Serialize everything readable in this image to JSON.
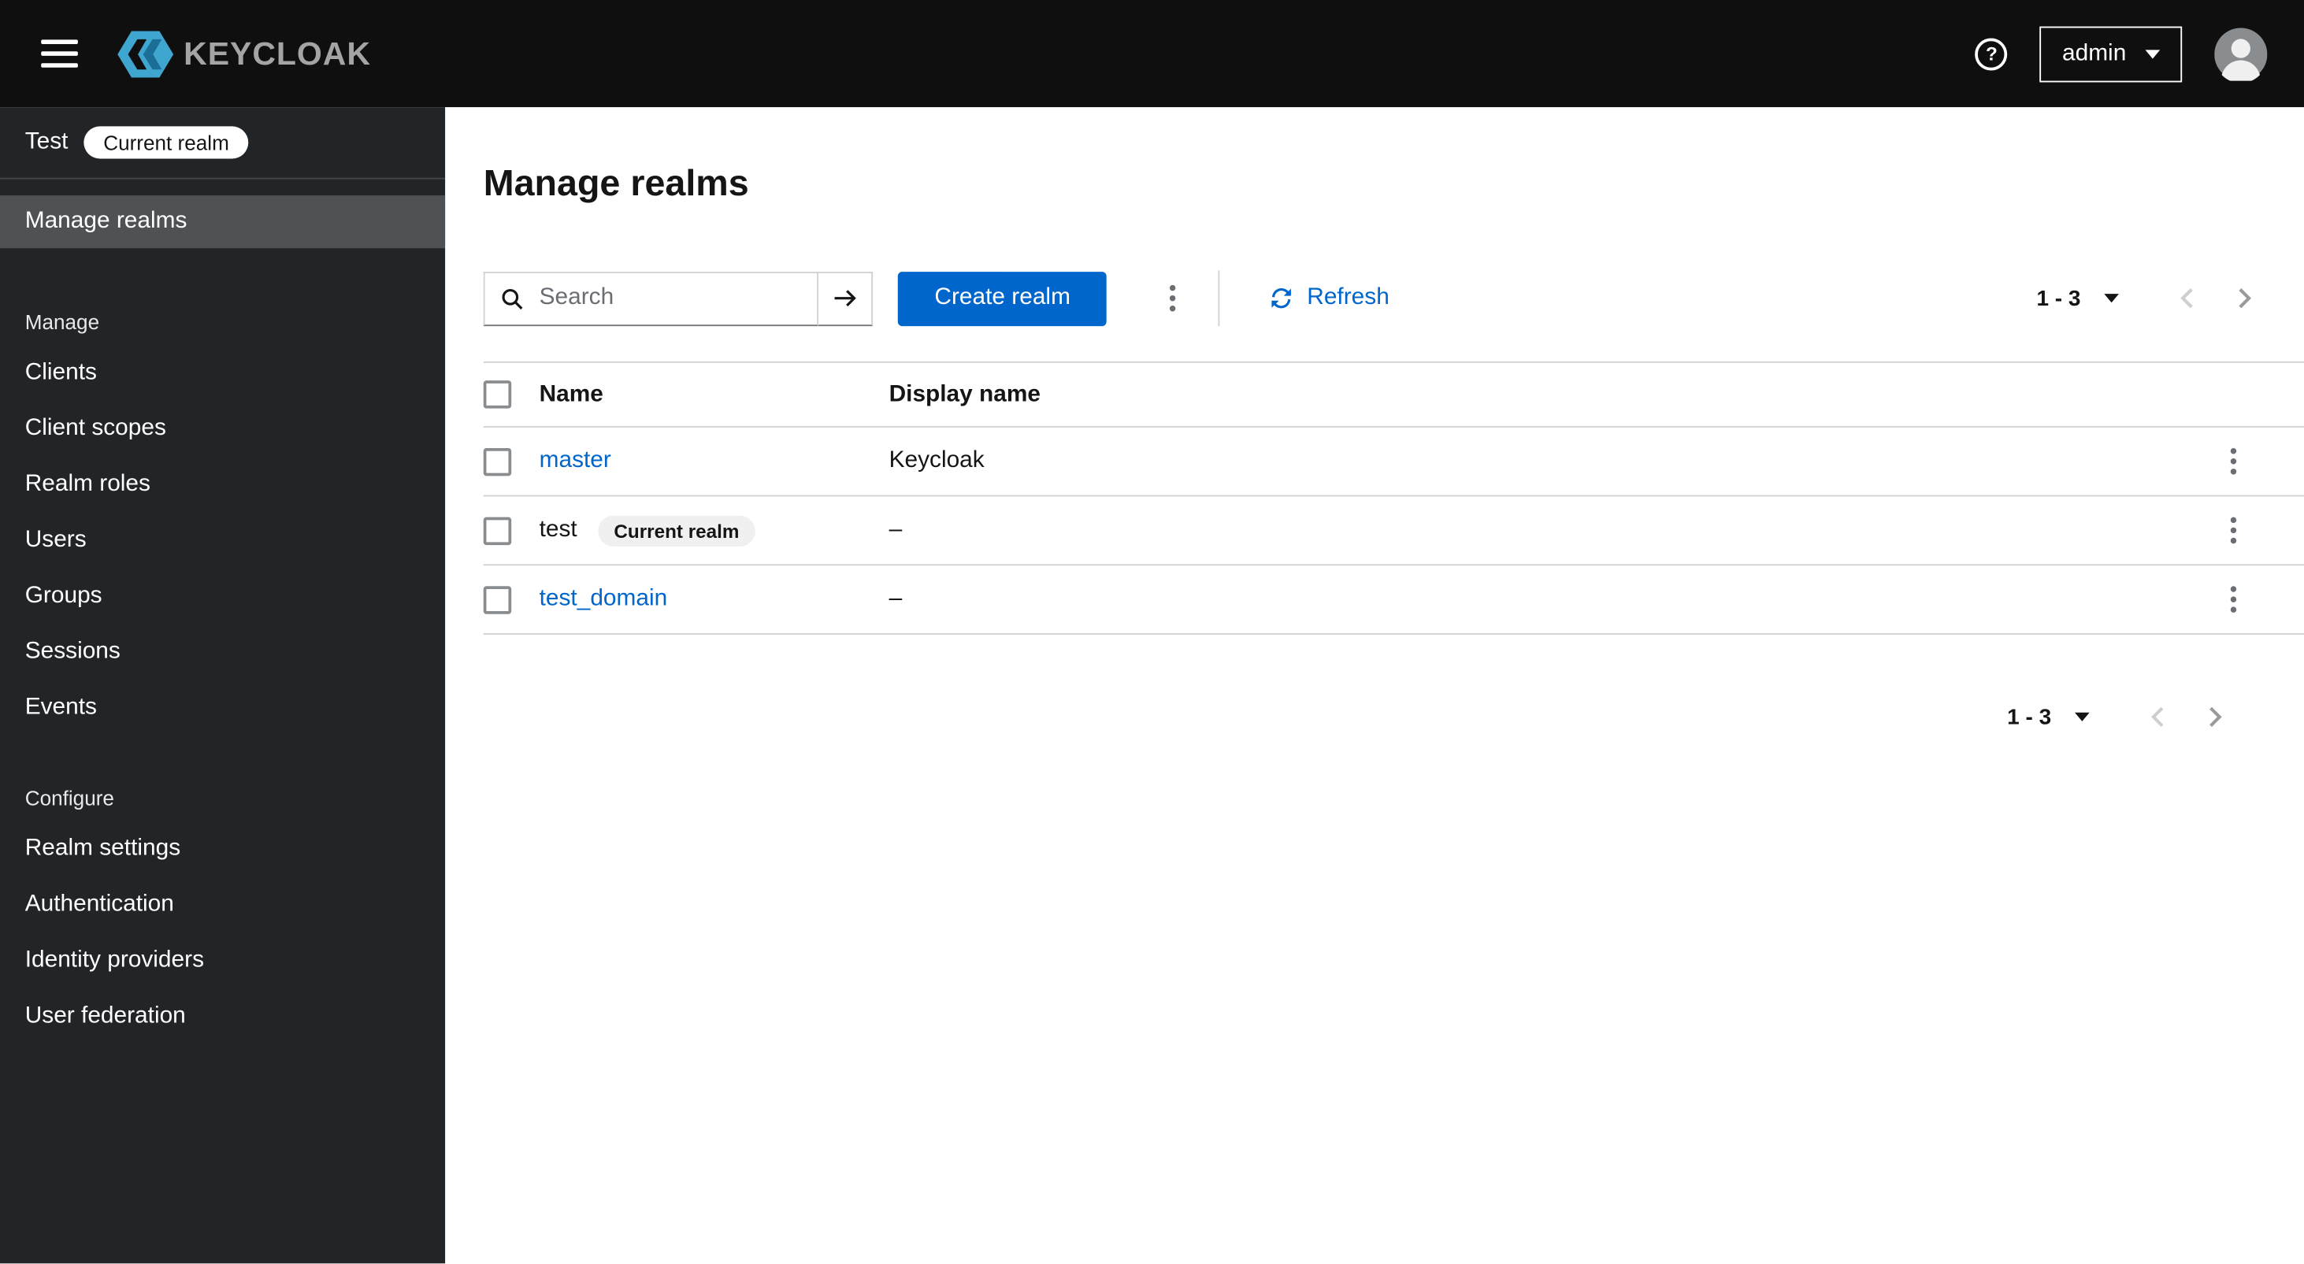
{
  "colors": {
    "accent": "#0066cc",
    "link": "#0066cc",
    "masthead_bg": "#0f0f0f",
    "sidebar_bg": "#222528",
    "sidebar_active_bg": "#4f5255"
  },
  "topbar": {
    "brand": "KEYCLOAK",
    "help_glyph": "?",
    "user_menu_label": "admin"
  },
  "sidebar": {
    "realm_name": "Test",
    "realm_badge": "Current realm",
    "active_item": "Manage realms",
    "sections": [
      {
        "label": "Manage",
        "items": [
          "Clients",
          "Client scopes",
          "Realm roles",
          "Users",
          "Groups",
          "Sessions",
          "Events"
        ]
      },
      {
        "label": "Configure",
        "items": [
          "Realm settings",
          "Authentication",
          "Identity providers",
          "User federation"
        ]
      }
    ]
  },
  "main": {
    "title": "Manage realms",
    "toolbar": {
      "search_placeholder": "Search",
      "create_button": "Create realm",
      "refresh_label": "Refresh",
      "pagination_range": "1 - 3"
    },
    "table": {
      "columns": [
        "Name",
        "Display name"
      ],
      "rows": [
        {
          "name": "master",
          "display_name": "Keycloak",
          "badge": ""
        },
        {
          "name": "test",
          "display_name": "–",
          "badge": "Current realm"
        },
        {
          "name": "test_domain",
          "display_name": "–",
          "badge": ""
        }
      ]
    },
    "bottom_pagination_range": "1 - 3"
  }
}
